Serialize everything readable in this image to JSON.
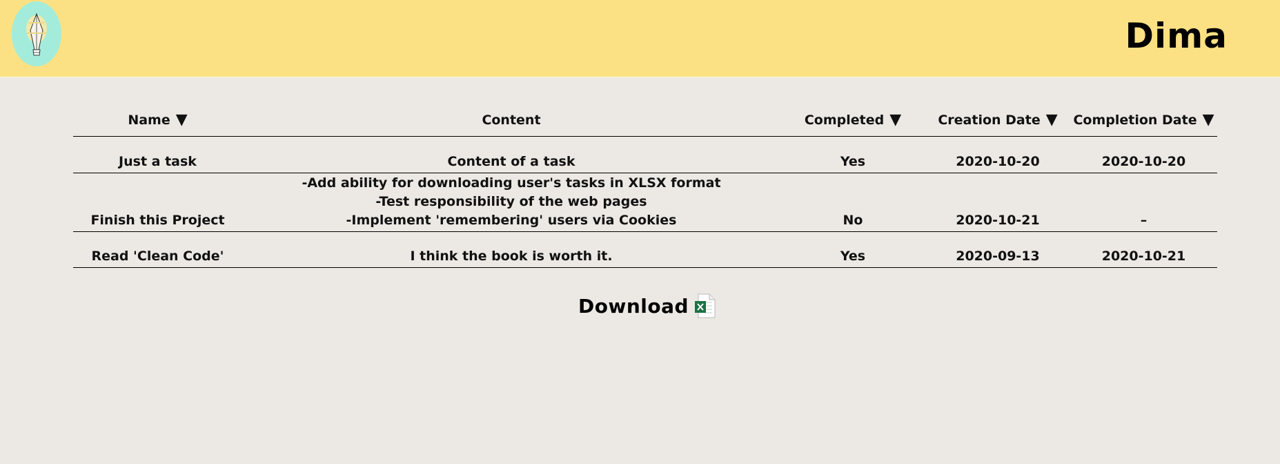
{
  "header": {
    "logo_icon": "lightbulb-balloon-icon",
    "username": "Dima",
    "background_color": "#fbe183",
    "logo_color": "#a3ecdb"
  },
  "table": {
    "columns": [
      {
        "label": "Name",
        "sortable": true
      },
      {
        "label": "Content",
        "sortable": false
      },
      {
        "label": "Completed",
        "sortable": true
      },
      {
        "label": "Creation Date",
        "sortable": true
      },
      {
        "label": "Completion Date",
        "sortable": true
      }
    ],
    "sort_icon": "▼",
    "rows": [
      {
        "name": "Just a task",
        "content": [
          "Content of a task"
        ],
        "completed": "Yes",
        "creation_date": "2020-10-20",
        "completion_date": "2020-10-20"
      },
      {
        "name": "Finish this Project",
        "content": [
          "-Add ability for downloading user's tasks in XLSX format",
          "-Test responsibility of the web pages",
          "-Implement 'remembering' users via Cookies"
        ],
        "completed": "No",
        "creation_date": "2020-10-21",
        "completion_date": "–"
      },
      {
        "name": "Read 'Clean Code'",
        "content": [
          "I think the book is worth it."
        ],
        "completed": "Yes",
        "creation_date": "2020-09-13",
        "completion_date": "2020-10-21"
      }
    ]
  },
  "download": {
    "label": "Download",
    "icon": "excel-file-icon",
    "icon_color": "#1e7145"
  }
}
